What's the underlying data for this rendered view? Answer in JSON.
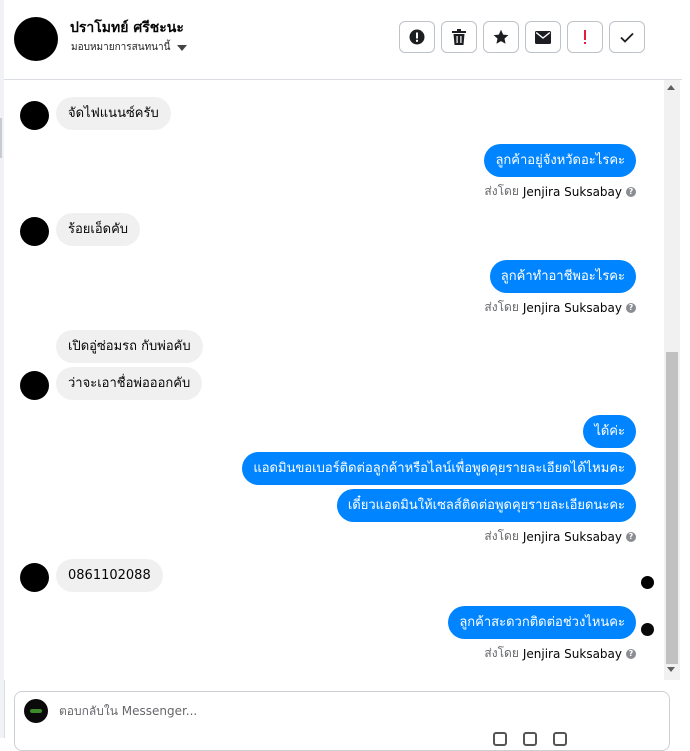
{
  "header": {
    "contact_name": "ปราโมทย์ ศรีชะนะ",
    "assign_label": "มอบหมายการสนทนานี้",
    "actions": [
      {
        "icon": "alert-circle-icon",
        "label": "Mark as spam"
      },
      {
        "icon": "trash-icon",
        "label": "Delete"
      },
      {
        "icon": "star-icon",
        "label": "Star"
      },
      {
        "icon": "envelope-icon",
        "label": "Mark as unread"
      },
      {
        "icon": "exclamation-icon",
        "label": "Follow up"
      },
      {
        "icon": "checkmark-icon",
        "label": "Mark as done"
      }
    ]
  },
  "conversation": {
    "messages": [
      {
        "from": "customer",
        "text": "จัดไฟแนนซ์ครับ"
      },
      {
        "from": "agent",
        "text": "ลูกค้าอยู่จังหวัดอะไรคะ"
      },
      {
        "from": "customer",
        "text": "ร้อยเอ็ดคับ"
      },
      {
        "from": "agent",
        "text": "ลูกค้าทำอาชีพอะไรคะ"
      },
      {
        "from": "customer",
        "text": "เปิดอู่ซ่อมรถ กับพ่อคับ"
      },
      {
        "from": "customer",
        "text": "ว่าจะเอาชื่อพ่อออกคับ"
      },
      {
        "from": "agent",
        "text": "ได้ค่ะ"
      },
      {
        "from": "agent",
        "text": "แอดมินขอเบอร์ติดต่อลูกค้าหรือไลน์เพื่อพูดคุยรายละเอียดได้ไหมคะ"
      },
      {
        "from": "agent",
        "text": "เดี๋ยวแอดมินให้เซลส์ติดต่อพูดคุยรายละเอียดนะคะ"
      },
      {
        "from": "customer",
        "text": "0861102088"
      },
      {
        "from": "agent",
        "text": "ลูกค้าสะดวกติดต่อช่วงไหนคะ"
      }
    ],
    "sent_by_prefix": "ส่งโดย",
    "agent_name": "Jenjira Suksabay",
    "info_glyph": "?"
  },
  "reply": {
    "placeholder": "ตอบกลับใน Messenger..."
  },
  "colors": {
    "agent_bubble": "#0084ff",
    "customer_bubble": "#f0f0f0",
    "meta_text": "#65676b"
  }
}
